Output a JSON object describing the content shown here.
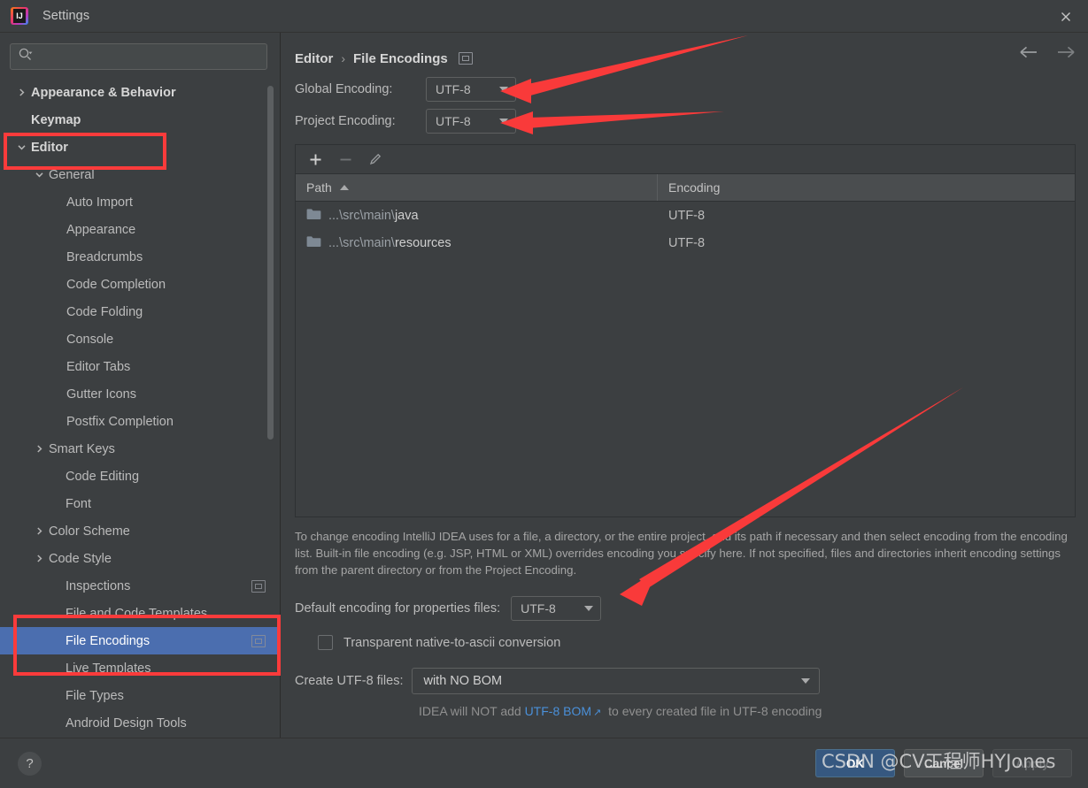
{
  "window": {
    "title": "Settings",
    "app_icon": "intellij-idea-icon",
    "close_label": "✕"
  },
  "sidebar": {
    "search": {
      "placeholder": "",
      "value": "",
      "icon": "search-icon"
    },
    "items": [
      {
        "label": "Appearance & Behavior",
        "level": 1,
        "twisty": "collapsed",
        "bold": true,
        "selected": false,
        "badge": false
      },
      {
        "label": "Keymap",
        "level": 1,
        "twisty": "none",
        "bold": true,
        "selected": false,
        "badge": false
      },
      {
        "label": "Editor",
        "level": 1,
        "twisty": "expanded",
        "bold": true,
        "selected": false,
        "badge": false,
        "highlight": true
      },
      {
        "label": "General",
        "level": 2,
        "twisty": "expanded",
        "bold": false,
        "selected": false,
        "badge": false
      },
      {
        "label": "Auto Import",
        "level": 3,
        "twisty": "none",
        "bold": false,
        "selected": false,
        "badge": false
      },
      {
        "label": "Appearance",
        "level": 3,
        "twisty": "none",
        "bold": false,
        "selected": false,
        "badge": false
      },
      {
        "label": "Breadcrumbs",
        "level": 3,
        "twisty": "none",
        "bold": false,
        "selected": false,
        "badge": false
      },
      {
        "label": "Code Completion",
        "level": 3,
        "twisty": "none",
        "bold": false,
        "selected": false,
        "badge": false
      },
      {
        "label": "Code Folding",
        "level": 3,
        "twisty": "none",
        "bold": false,
        "selected": false,
        "badge": false
      },
      {
        "label": "Console",
        "level": 3,
        "twisty": "none",
        "bold": false,
        "selected": false,
        "badge": false
      },
      {
        "label": "Editor Tabs",
        "level": 3,
        "twisty": "none",
        "bold": false,
        "selected": false,
        "badge": false
      },
      {
        "label": "Gutter Icons",
        "level": 3,
        "twisty": "none",
        "bold": false,
        "selected": false,
        "badge": false
      },
      {
        "label": "Postfix Completion",
        "level": 3,
        "twisty": "none",
        "bold": false,
        "selected": false,
        "badge": false
      },
      {
        "label": "Smart Keys",
        "level": 2,
        "twisty": "collapsed",
        "bold": false,
        "selected": false,
        "badge": false
      },
      {
        "label": "Code Editing",
        "level": 2,
        "twisty": "none",
        "bold": false,
        "selected": false,
        "badge": false
      },
      {
        "label": "Font",
        "level": 2,
        "twisty": "none",
        "bold": false,
        "selected": false,
        "badge": false
      },
      {
        "label": "Color Scheme",
        "level": 2,
        "twisty": "collapsed",
        "bold": false,
        "selected": false,
        "badge": false
      },
      {
        "label": "Code Style",
        "level": 2,
        "twisty": "collapsed",
        "bold": false,
        "selected": false,
        "badge": false
      },
      {
        "label": "Inspections",
        "level": 2,
        "twisty": "none",
        "bold": false,
        "selected": false,
        "badge": true
      },
      {
        "label": "File and Code Templates",
        "level": 2,
        "twisty": "none",
        "bold": false,
        "selected": false,
        "badge": false
      },
      {
        "label": "File Encodings",
        "level": 2,
        "twisty": "none",
        "bold": false,
        "selected": true,
        "badge": true
      },
      {
        "label": "Live Templates",
        "level": 2,
        "twisty": "none",
        "bold": false,
        "selected": false,
        "badge": false
      },
      {
        "label": "File Types",
        "level": 2,
        "twisty": "none",
        "bold": false,
        "selected": false,
        "badge": false
      },
      {
        "label": "Android Design Tools",
        "level": 2,
        "twisty": "none",
        "bold": false,
        "selected": false,
        "badge": false
      }
    ]
  },
  "main": {
    "breadcrumb": {
      "parent": "Editor",
      "separator": "›",
      "current": "File Encodings",
      "badge": "project-scope-icon"
    },
    "nav": {
      "back_icon": "arrow-left-icon",
      "forward_icon": "arrow-right-icon"
    },
    "global_encoding": {
      "label": "Global Encoding:",
      "value": "UTF-8"
    },
    "project_encoding": {
      "label": "Project Encoding:",
      "value": "UTF-8"
    },
    "table": {
      "toolbar": {
        "add": "+",
        "remove": "−",
        "edit": "pencil-icon"
      },
      "columns": [
        "Path",
        "Encoding"
      ],
      "sort_column": "Path",
      "sort_direction": "ascending",
      "rows": [
        {
          "path_prefix": "...\\src\\main\\",
          "path_name": "java",
          "encoding": "UTF-8"
        },
        {
          "path_prefix": "...\\src\\main\\",
          "path_name": "resources",
          "encoding": "UTF-8"
        }
      ]
    },
    "description": "To change encoding IntelliJ IDEA uses for a file, a directory, or the entire project, add its path if necessary and then select encoding from the encoding list. Built-in file encoding (e.g. JSP, HTML or XML) overrides encoding you specify here. If not specified, files and directories inherit encoding settings from the parent directory or from the Project Encoding.",
    "properties_encoding": {
      "label": "Default encoding for properties files:",
      "value": "UTF-8"
    },
    "transparent_conversion": {
      "label": "Transparent native-to-ascii conversion",
      "checked": false
    },
    "create_utf8": {
      "label": "Create UTF-8 files:",
      "value": "with NO BOM"
    },
    "bom_note": {
      "before": "IDEA will NOT add ",
      "link": "UTF-8 BOM",
      "link_icon": "↗",
      "after": " to every created file in UTF-8 encoding"
    }
  },
  "footer": {
    "help_label": "?",
    "ok_label": "OK",
    "cancel_label": "Cancel",
    "apply_label": "Apply"
  },
  "annotations": {
    "accent_color": "#f93a3a",
    "highlight_color": "#fb3b3b",
    "watermark": "CSDN @CV工程师HYJones"
  },
  "colors": {
    "background": "#3c3f41",
    "selection": "#4b6eaf",
    "primary_button": "#365880",
    "link": "#4a90d9",
    "text": "#bbbbbb"
  }
}
